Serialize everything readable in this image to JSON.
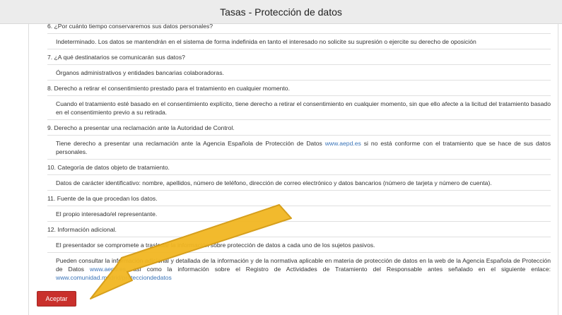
{
  "window": {
    "title": "Tasas - Protección de datos"
  },
  "sections": [
    {
      "q": "6. ¿Por cuánto tiempo conservaremos sus datos personales?",
      "a": "Indeterminado. Los datos se mantendrán en el sistema de forma indefinida en tanto el interesado no solicite su supresión o ejercite su derecho de oposición"
    },
    {
      "q": "7. ¿A qué destinatarios se comunicarán sus datos?",
      "a": "Órganos administrativos y entidades bancarias colaboradoras."
    },
    {
      "q": "8. Derecho a retirar el consentimiento prestado para el tratamiento en cualquier momento.",
      "a": "Cuando el tratamiento esté basado en el consentimiento explícito, tiene derecho a retirar el consentimiento en cualquier momento, sin que ello afecte a la licitud del tratamiento basado en el consentimiento previo a su retirada."
    },
    {
      "q": "9. Derecho a presentar una reclamación ante la Autoridad de Control.",
      "a_pre": "Tiene derecho a presentar una reclamación ante la Agencia Española de Protección de Datos ",
      "a_link": "www.aepd.es",
      "a_post": " si no está conforme con el tratamiento que se hace de sus datos personales."
    },
    {
      "q": "10. Categoría de datos objeto de tratamiento.",
      "a": "Datos de carácter identificativo: nombre, apellidos, número de teléfono, dirección de correo electrónico y datos bancarios (número de tarjeta y número de cuenta)."
    },
    {
      "q": "11. Fuente de la que procedan los datos.",
      "a": "El propio interesado/el representante."
    },
    {
      "q": "12. Información adicional.",
      "a": "El presentador se compromete a trasladar la información sobre protección de datos a cada uno de los sujetos pasivos.",
      "a2_pre": "Pueden consultar la información adicional y detallada de la información y de la normativa aplicable en materia de protección de datos en la web de la Agencia Española de Protección de Datos ",
      "a2_link1": "www.aepd.es",
      "a2_mid": ", así como la información sobre el Registro de Actividades de Tratamiento del Responsable antes señalado en el siguiente enlace: ",
      "a2_link2": "www.comunidad.madrid/protecciondedatos"
    }
  ],
  "buttons": {
    "accept_label": "Aceptar"
  },
  "colors": {
    "accept_bg": "#c9302c",
    "link": "#3a74b8",
    "arrow_fill": "#f2b722",
    "arrow_stroke": "#d49a10"
  }
}
